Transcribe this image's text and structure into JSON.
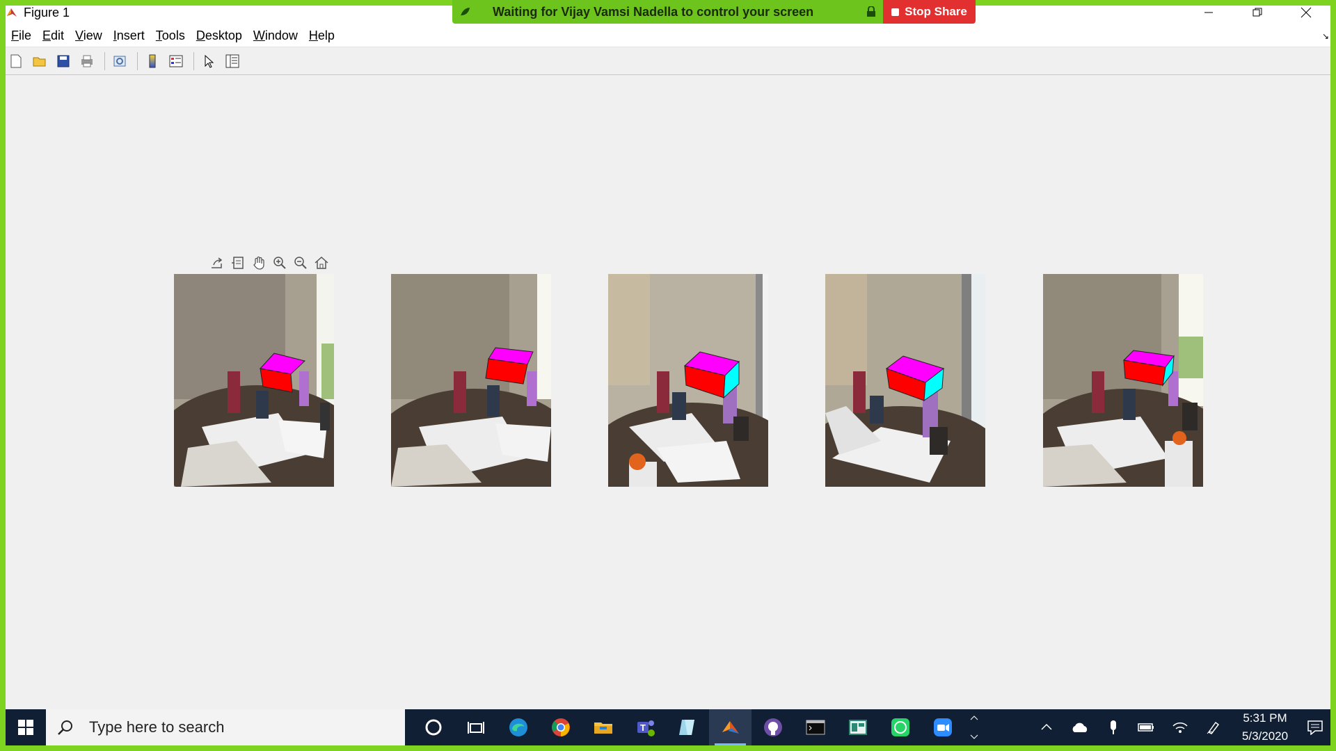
{
  "window": {
    "title": "Figure 1"
  },
  "share_banner": {
    "status": "Waiting for Vijay Vamsi Nadella to control your screen",
    "stop_label": "Stop Share",
    "border_color": "#7ed321",
    "stop_color": "#e23030"
  },
  "menu": {
    "items": [
      {
        "label": "File",
        "underline": "F"
      },
      {
        "label": "Edit",
        "underline": "E"
      },
      {
        "label": "View",
        "underline": "V"
      },
      {
        "label": "Insert",
        "underline": "I"
      },
      {
        "label": "Tools",
        "underline": "T"
      },
      {
        "label": "Desktop",
        "underline": "D"
      },
      {
        "label": "Window",
        "underline": "W"
      },
      {
        "label": "Help",
        "underline": "H"
      }
    ]
  },
  "toolbar": {
    "icons": [
      "new-figure-icon",
      "open-file-icon",
      "save-icon",
      "print-icon",
      "link-plot-icon",
      "colorbar-icon",
      "legend-icon",
      "edit-plot-icon",
      "property-inspector-icon"
    ]
  },
  "axes_toolbar": {
    "icons": [
      "export-icon",
      "brush-icon",
      "pan-icon",
      "zoom-in-icon",
      "zoom-out-icon",
      "home-icon"
    ]
  },
  "images": [
    {
      "name": "photo-1-with-cube",
      "cube_top": "#ff00ff",
      "cube_front": "#ff0000",
      "cube_side": "#00ffff"
    },
    {
      "name": "photo-2-with-cube",
      "cube_top": "#ff00ff",
      "cube_front": "#ff0000",
      "cube_side": "#00ffff"
    },
    {
      "name": "photo-3-with-cube",
      "cube_top": "#ff00ff",
      "cube_front": "#ff0000",
      "cube_side": "#00ffff"
    },
    {
      "name": "photo-4-with-cube",
      "cube_top": "#ff00ff",
      "cube_front": "#ff0000",
      "cube_side": "#00ffff"
    },
    {
      "name": "photo-5-with-cube",
      "cube_top": "#ff00ff",
      "cube_front": "#ff0000",
      "cube_side": "#00ffff"
    }
  ],
  "taskbar": {
    "search_placeholder": "Type here to search",
    "apps": [
      "cortana-icon",
      "task-view-icon",
      "edge-icon",
      "chrome-icon",
      "file-explorer-icon",
      "teams-icon",
      "notepad-icon",
      "matlab-icon",
      "github-icon",
      "terminal-icon",
      "app-icon",
      "whatsapp-icon",
      "zoom-icon"
    ],
    "time": "5:31 PM",
    "date": "5/3/2020"
  }
}
